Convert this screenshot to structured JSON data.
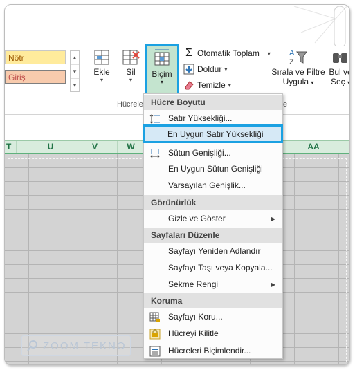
{
  "styles": {
    "notr": "Nötr",
    "giris": "Giriş"
  },
  "cells_group": {
    "ekle": "Ekle",
    "sil": "Sil",
    "bicim": "Biçim",
    "label": "Hücreler"
  },
  "editing_group": {
    "autosum": "Otomatik Toplam",
    "fill": "Doldur",
    "clear": "Temizle",
    "sort_filter_line1": "Sırala ve Filtre",
    "sort_filter_line2": "Uygula",
    "find_line1": "Bul ve",
    "find_line2": "Seç",
    "label_tail": "e"
  },
  "columns": [
    "T",
    "U",
    "V",
    "W",
    "AA"
  ],
  "menu": {
    "h_size": "Hücre Boyutu",
    "row_height": "Satır Yüksekliği...",
    "autofit_row": "En Uygun Satır Yüksekliği",
    "col_width": "Sütun Genişliği...",
    "autofit_col": "En Uygun Sütun Genişliği",
    "default_width": "Varsayılan Genişlik...",
    "h_visibility": "Görünürlük",
    "hide_show": "Gizle ve Göster",
    "h_organize": "Sayfaları Düzenle",
    "rename": "Sayfayı Yeniden Adlandır",
    "move_copy": "Sayfayı Taşı veya Kopyala...",
    "tab_color": "Sekme Rengi",
    "h_protection": "Koruma",
    "protect_sheet": "Sayfayı Koru...",
    "lock_cell": "Hücreyi Kilitle",
    "format_cells": "Hücreleri Biçimlendir..."
  },
  "watermark": "ZOOM TEKNO",
  "colors": {
    "accent": "#1ba1e2",
    "excel_green": "#217346",
    "highlight": "#c4e4cf"
  }
}
